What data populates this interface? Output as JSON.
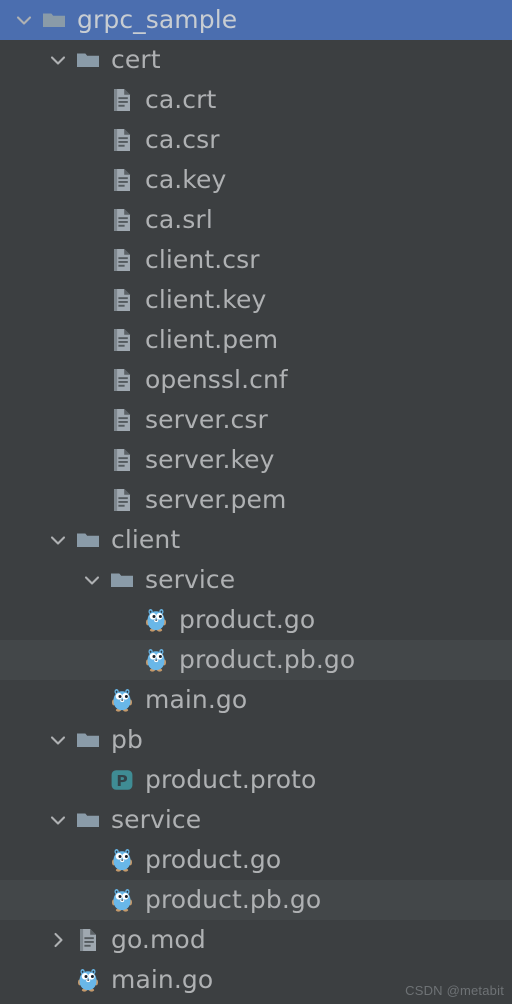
{
  "theme": {
    "background": "#3C3F41",
    "selected_row": "#4B6EAF",
    "highlight_row": "#434749",
    "text": "#AFB1B3",
    "folder_icon": "#8A9BA8",
    "file_icon": "#9FA8B0",
    "go_icon": "#69B7E8",
    "proto_icon": "#3F8C94",
    "watermark_text": "#6E7275"
  },
  "watermark": "CSDN @metabit",
  "tree": {
    "nodes": [
      {
        "label": "grpc_sample",
        "depth": 0,
        "icon": "folder-icon",
        "twisty": "chevron-down-icon",
        "state": "selected"
      },
      {
        "label": "cert",
        "depth": 1,
        "icon": "folder-icon",
        "twisty": "chevron-down-icon",
        "state": "normal"
      },
      {
        "label": "ca.crt",
        "depth": 2,
        "icon": "file-icon",
        "twisty": "none",
        "state": "normal"
      },
      {
        "label": "ca.csr",
        "depth": 2,
        "icon": "file-icon",
        "twisty": "none",
        "state": "normal"
      },
      {
        "label": "ca.key",
        "depth": 2,
        "icon": "file-icon",
        "twisty": "none",
        "state": "normal"
      },
      {
        "label": "ca.srl",
        "depth": 2,
        "icon": "file-icon",
        "twisty": "none",
        "state": "normal"
      },
      {
        "label": "client.csr",
        "depth": 2,
        "icon": "file-icon",
        "twisty": "none",
        "state": "normal"
      },
      {
        "label": "client.key",
        "depth": 2,
        "icon": "file-icon",
        "twisty": "none",
        "state": "normal"
      },
      {
        "label": "client.pem",
        "depth": 2,
        "icon": "file-icon",
        "twisty": "none",
        "state": "normal"
      },
      {
        "label": "openssl.cnf",
        "depth": 2,
        "icon": "file-icon",
        "twisty": "none",
        "state": "normal"
      },
      {
        "label": "server.csr",
        "depth": 2,
        "icon": "file-icon",
        "twisty": "none",
        "state": "normal"
      },
      {
        "label": "server.key",
        "depth": 2,
        "icon": "file-icon",
        "twisty": "none",
        "state": "normal"
      },
      {
        "label": "server.pem",
        "depth": 2,
        "icon": "file-icon",
        "twisty": "none",
        "state": "normal"
      },
      {
        "label": "client",
        "depth": 1,
        "icon": "folder-icon",
        "twisty": "chevron-down-icon",
        "state": "normal"
      },
      {
        "label": "service",
        "depth": 2,
        "icon": "folder-icon",
        "twisty": "chevron-down-icon",
        "state": "normal"
      },
      {
        "label": "product.go",
        "depth": 3,
        "icon": "go-file-icon",
        "twisty": "none",
        "state": "normal"
      },
      {
        "label": "product.pb.go",
        "depth": 3,
        "icon": "go-file-icon",
        "twisty": "none",
        "state": "highlight"
      },
      {
        "label": "main.go",
        "depth": 2,
        "icon": "go-file-icon",
        "twisty": "none",
        "state": "normal"
      },
      {
        "label": "pb",
        "depth": 1,
        "icon": "folder-icon",
        "twisty": "chevron-down-icon",
        "state": "normal"
      },
      {
        "label": "product.proto",
        "depth": 2,
        "icon": "proto-file-icon",
        "twisty": "none",
        "state": "normal"
      },
      {
        "label": "service",
        "depth": 1,
        "icon": "folder-icon",
        "twisty": "chevron-down-icon",
        "state": "normal"
      },
      {
        "label": "product.go",
        "depth": 2,
        "icon": "go-file-icon",
        "twisty": "none",
        "state": "normal"
      },
      {
        "label": "product.pb.go",
        "depth": 2,
        "icon": "go-file-icon",
        "twisty": "none",
        "state": "highlight"
      },
      {
        "label": "go.mod",
        "depth": 1,
        "icon": "file-icon",
        "twisty": "chevron-right-icon",
        "state": "normal"
      },
      {
        "label": "main.go",
        "depth": 1,
        "icon": "go-file-icon",
        "twisty": "none",
        "state": "normal"
      }
    ]
  }
}
